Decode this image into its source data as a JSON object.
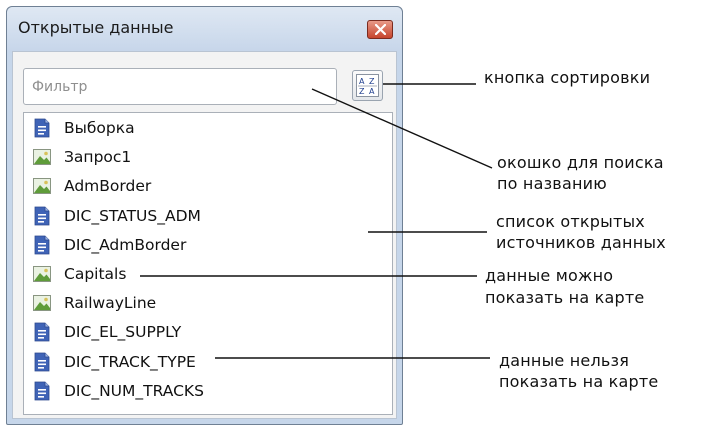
{
  "window": {
    "title": "Открытые данные",
    "filter_placeholder": "Фильтр"
  },
  "list": {
    "items": [
      {
        "label": "Выборка",
        "icon": "document-icon"
      },
      {
        "label": "Запрос1",
        "icon": "map-image-icon"
      },
      {
        "label": "AdmBorder",
        "icon": "map-image-icon"
      },
      {
        "label": "DIC_STATUS_ADM",
        "icon": "document-icon"
      },
      {
        "label": "DIC_AdmBorder",
        "icon": "document-icon"
      },
      {
        "label": "Capitals",
        "icon": "map-image-icon"
      },
      {
        "label": "RailwayLine",
        "icon": "map-image-icon"
      },
      {
        "label": "DIC_EL_SUPPLY",
        "icon": "document-icon"
      },
      {
        "label": "DIC_TRACK_TYPE",
        "icon": "document-icon"
      },
      {
        "label": "DIC_NUM_TRACKS",
        "icon": "document-icon"
      }
    ]
  },
  "annotations": {
    "sort_button": "кнопка сортировки",
    "search_box_line1": "окошко для поиска",
    "search_box_line2": "по названию",
    "list_line1": "список открытых",
    "list_line2": "источников данных",
    "map_line1": "данные можно",
    "map_line2": "показать на карте",
    "nomap_line1": "данные нельзя",
    "nomap_line2": "показать на карте"
  },
  "colors": {
    "document_icon": "#3f63b6",
    "map_icon_green": "#5f9c3a",
    "close_button": "#c6452d"
  }
}
